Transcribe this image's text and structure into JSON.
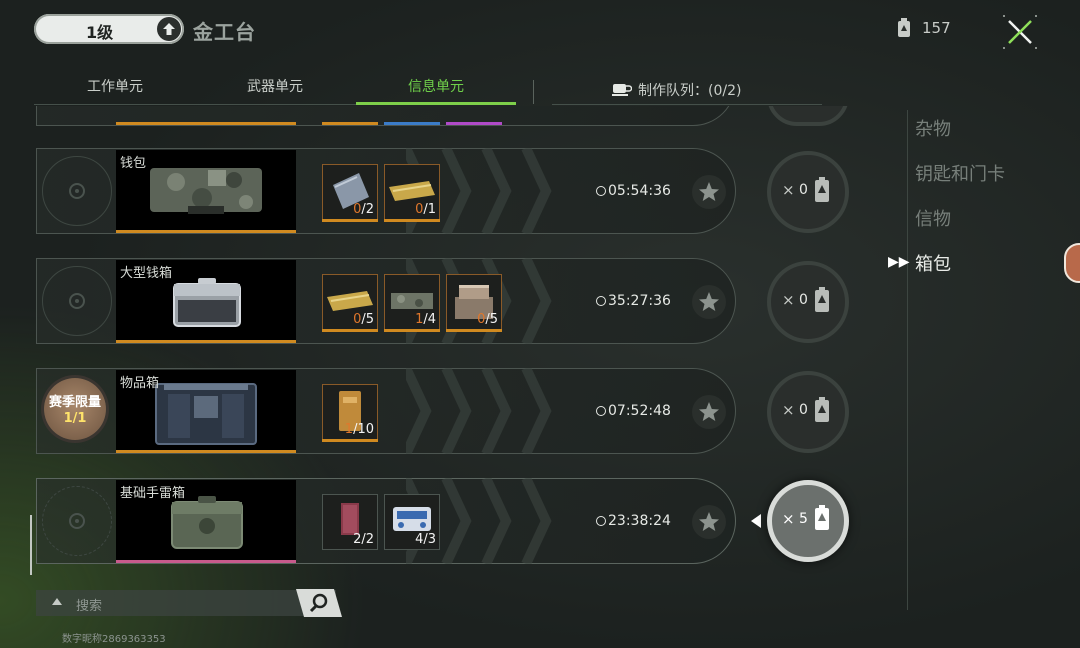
{
  "header": {
    "level": "1级",
    "station_title": "金工台",
    "currency_icon": "battery-icon",
    "currency_value": "157",
    "close_icon": "close-x-icon"
  },
  "tabs": [
    {
      "label": "工作单元",
      "active": false
    },
    {
      "label": "武器单元",
      "active": false
    },
    {
      "label": "信息单元",
      "active": true
    }
  ],
  "queue": {
    "icon": "cup-icon",
    "label": "制作队列：(0/2)"
  },
  "recipes": [
    {
      "name": "钱包",
      "materials": [
        {
          "have": "0",
          "need": "/2",
          "insufficient": true
        },
        {
          "have": "0",
          "need": "/1",
          "insufficient": true
        }
      ],
      "time": "05:54:36",
      "craft_count": "0",
      "selected": false
    },
    {
      "name": "大型钱箱",
      "materials": [
        {
          "have": "0",
          "need": "/5",
          "insufficient": true
        },
        {
          "have": "1",
          "need": "/4",
          "insufficient": true
        },
        {
          "have": "0",
          "need": "/5",
          "insufficient": true
        }
      ],
      "time": "35:27:36",
      "craft_count": "0",
      "selected": false
    },
    {
      "name": "物品箱",
      "season_limit": {
        "label": "赛季限量",
        "count": "1/1"
      },
      "materials": [
        {
          "have": "1",
          "need": "/10",
          "insufficient": true
        }
      ],
      "time": "07:52:48",
      "craft_count": "0",
      "selected": false
    },
    {
      "name": "基础手雷箱",
      "materials": [
        {
          "have": "2",
          "need": "/2",
          "insufficient": false
        },
        {
          "have": "4",
          "need": "/3",
          "insufficient": false
        }
      ],
      "time": "23:38:24",
      "craft_count": "5",
      "selected": true
    }
  ],
  "craft_multiplier": "×",
  "categories": [
    {
      "label": "杂物",
      "active": false
    },
    {
      "label": "钥匙和门卡",
      "active": false
    },
    {
      "label": "信物",
      "active": false
    },
    {
      "label": "箱包",
      "active": true
    }
  ],
  "search": {
    "placeholder": "搜索",
    "icon": "search-icon"
  },
  "user_id": "数字昵称2869363353",
  "colors": {
    "accent_green": "#7ecf4a",
    "rarity_orange": "#d08a20",
    "rarity_pink": "#c85a8c",
    "shortfall": "#e0772c"
  }
}
